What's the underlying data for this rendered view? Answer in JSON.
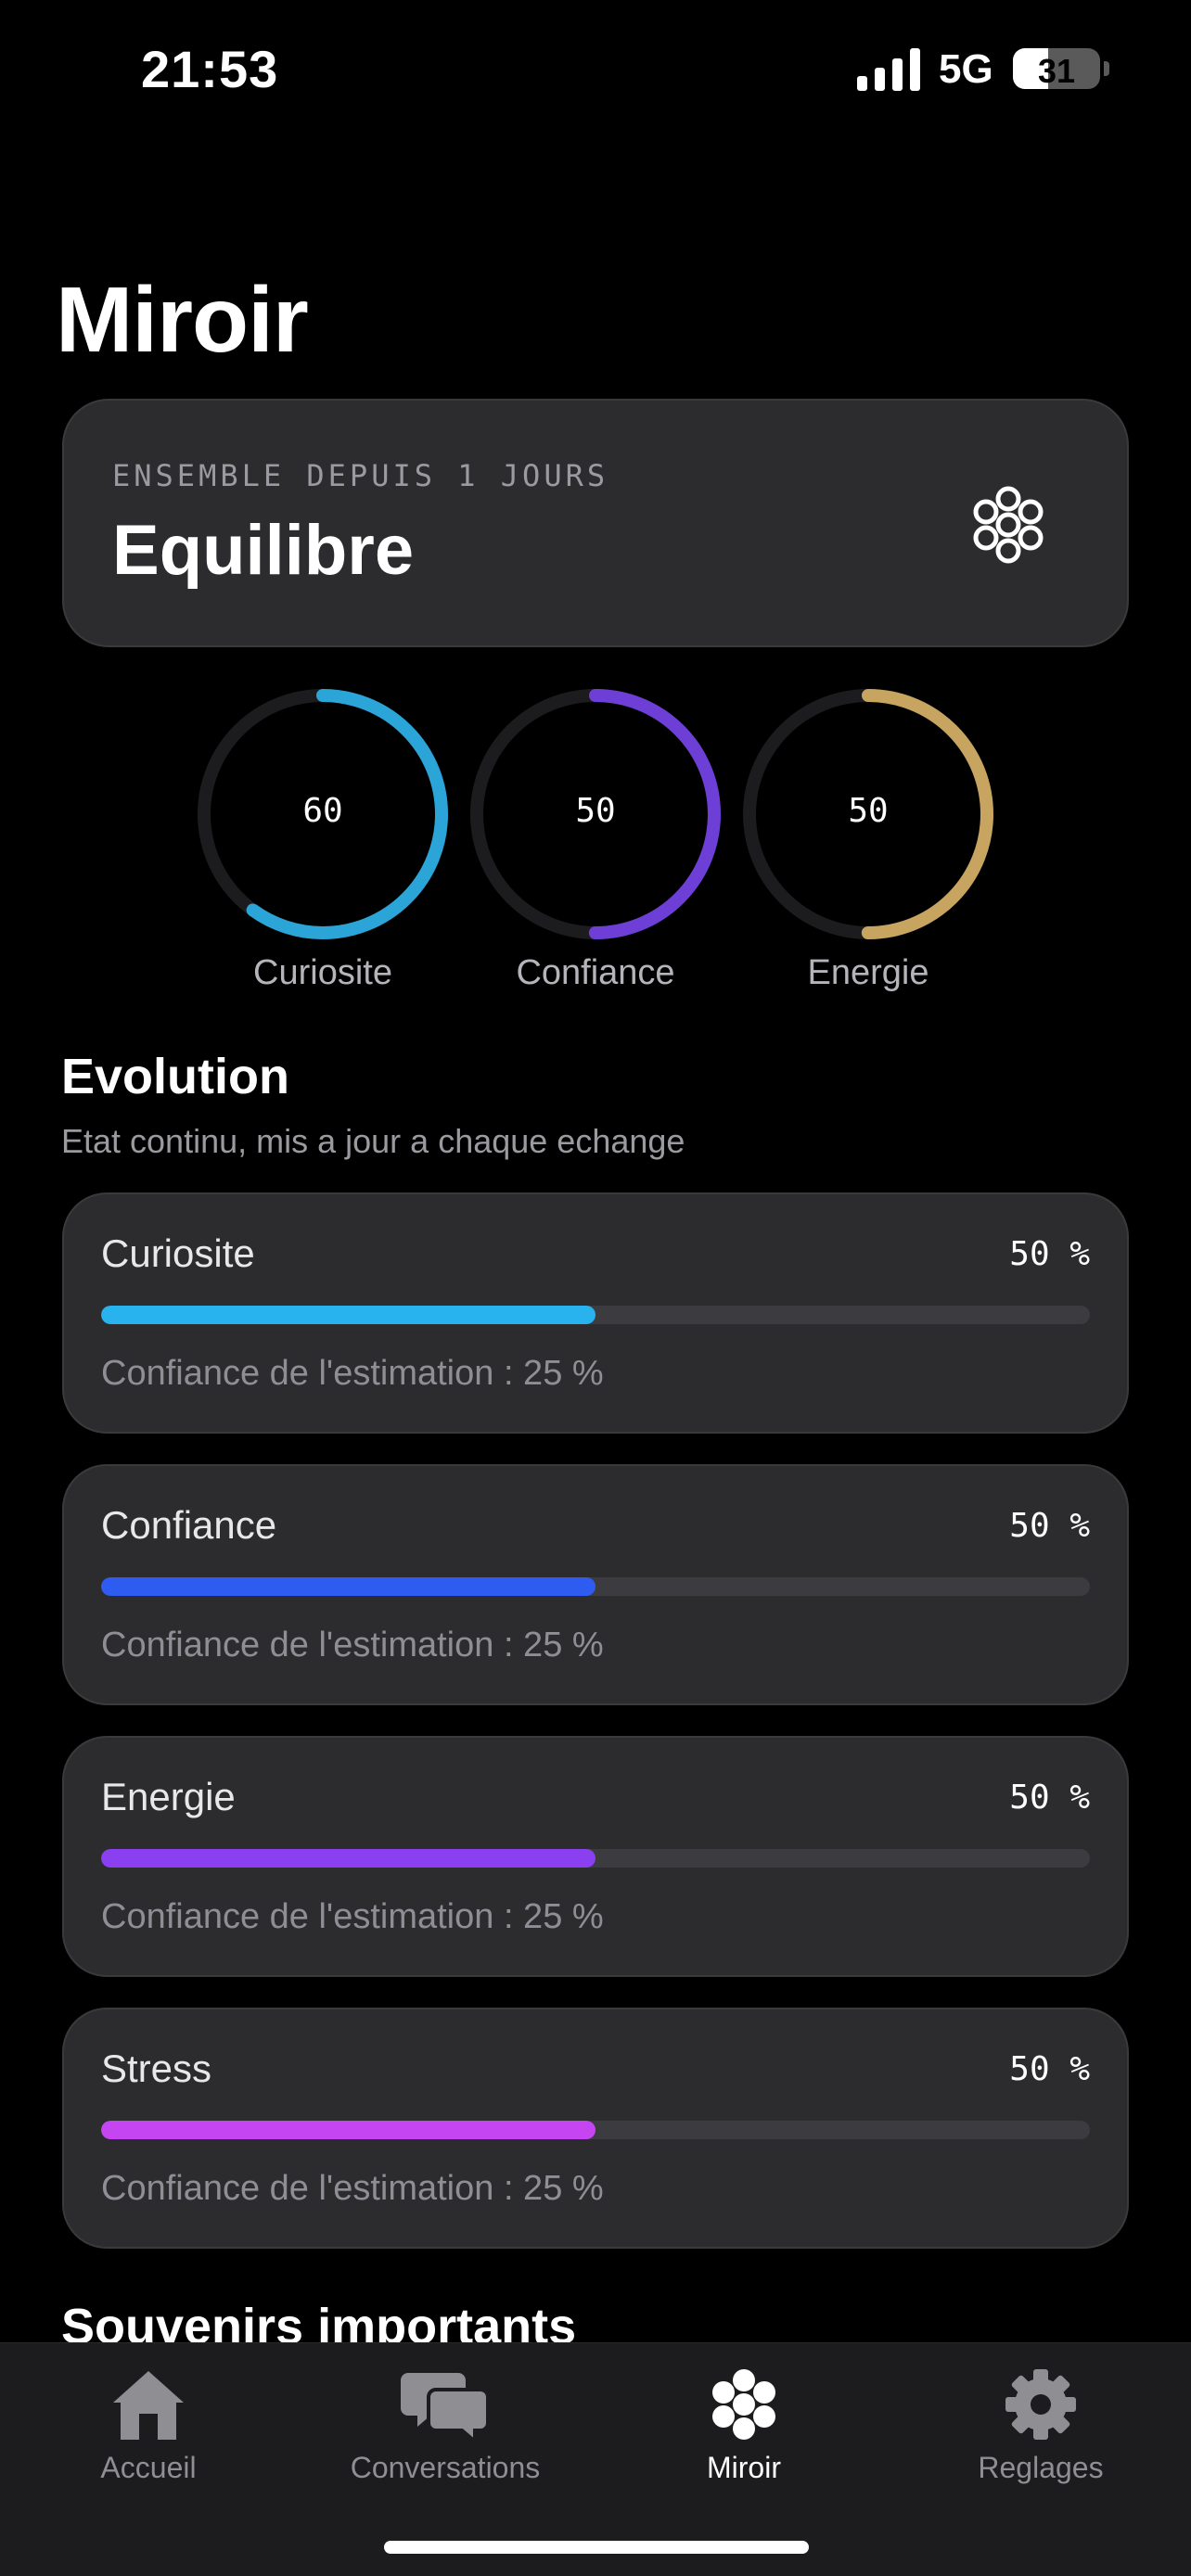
{
  "status_bar": {
    "time": "21:53",
    "network": "5G",
    "battery": "31"
  },
  "page_title": "Miroir",
  "header_card": {
    "since": "ENSEMBLE DEPUIS 1 JOURS",
    "state": "Equilibre",
    "icon": "flower-icon"
  },
  "gauges": [
    {
      "label": "Curiosite",
      "value": "60",
      "fraction": 0.6,
      "color": "#2ba4d8"
    },
    {
      "label": "Confiance",
      "value": "50",
      "fraction": 0.5,
      "color": "#6d3fd6"
    },
    {
      "label": "Energie",
      "value": "50",
      "fraction": 0.5,
      "color": "#c7a560"
    }
  ],
  "evolution": {
    "title": "Evolution",
    "subtitle": "Etat continu, mis a jour a chaque echange",
    "metrics": [
      {
        "name": "Curiosite",
        "percent": "50 %",
        "fraction": 0.5,
        "confidence": "Confiance de l'estimation : 25 %",
        "color": "#28b2ee"
      },
      {
        "name": "Confiance",
        "percent": "50 %",
        "fraction": 0.5,
        "confidence": "Confiance de l'estimation : 25 %",
        "color": "#2f5cf0"
      },
      {
        "name": "Energie",
        "percent": "50 %",
        "fraction": 0.5,
        "confidence": "Confiance de l'estimation : 25 %",
        "color": "#8a3ff0"
      },
      {
        "name": "Stress",
        "percent": "50 %",
        "fraction": 0.5,
        "confidence": "Confiance de l'estimation : 25 %",
        "color": "#c545f2"
      }
    ]
  },
  "next_section_title": "Souvenirs importants",
  "tab_bar": [
    {
      "label": "Accueil",
      "icon": "house-icon",
      "active": false
    },
    {
      "label": "Conversations",
      "icon": "chat-bubbles-icon",
      "active": false
    },
    {
      "label": "Miroir",
      "icon": "flower-icon",
      "active": true
    },
    {
      "label": "Reglages",
      "icon": "gear-icon",
      "active": false
    }
  ]
}
